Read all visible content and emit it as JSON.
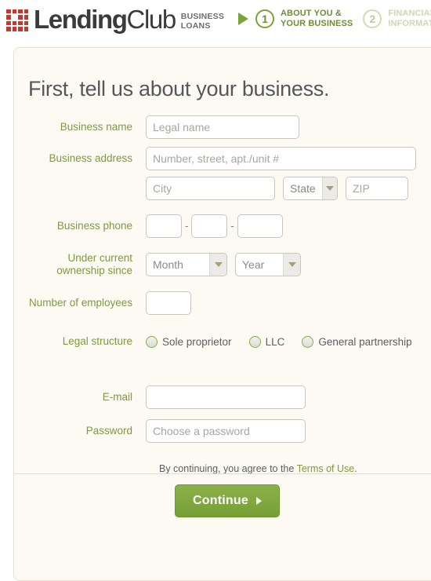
{
  "header": {
    "brand": {
      "name_bold": "Lending",
      "name_light": "Club",
      "sub_line1": "BUSINESS",
      "sub_line2": "LOANS",
      "logo_color": "#c4392f"
    },
    "steps": [
      {
        "number": "1",
        "line1": "ABOUT YOU &",
        "line2": "YOUR BUSINESS",
        "state": "active"
      },
      {
        "number": "2",
        "line1": "FINANCIAL",
        "line2": "INFORMATION",
        "state": "inactive"
      }
    ],
    "accent_green": "#7ba23d"
  },
  "form": {
    "title": "First, tell us about your business.",
    "labels": {
      "business_name": "Business name",
      "business_address": "Business address",
      "business_phone": "Business phone",
      "ownership_line1": "Under current",
      "ownership_line2": "ownership since",
      "employees": "Number of employees",
      "legal_structure": "Legal structure",
      "email": "E-mail",
      "password": "Password"
    },
    "placeholders": {
      "legal_name": "Legal name",
      "street": "Number, street, apt./unit #",
      "city": "City",
      "zip": "ZIP",
      "password": "Choose a password"
    },
    "values": {
      "legal_name": "",
      "street": "",
      "city": "",
      "zip": "",
      "phone1": "",
      "phone2": "",
      "phone3": "",
      "employees": "",
      "email": "",
      "password": ""
    },
    "selects": {
      "state": "State",
      "month": "Month",
      "year": "Year"
    },
    "phone_separator": "-",
    "legal_structure_options": [
      {
        "label": "Sole proprietor",
        "selected": false
      },
      {
        "label": "LLC",
        "selected": false
      },
      {
        "label": "General partnership",
        "selected": false
      }
    ],
    "terms": {
      "prefix": "By continuing, you agree to the ",
      "link": "Terms of Use",
      "suffix": "."
    },
    "submit": {
      "label": "Continue",
      "color": "#7aa33c"
    }
  }
}
